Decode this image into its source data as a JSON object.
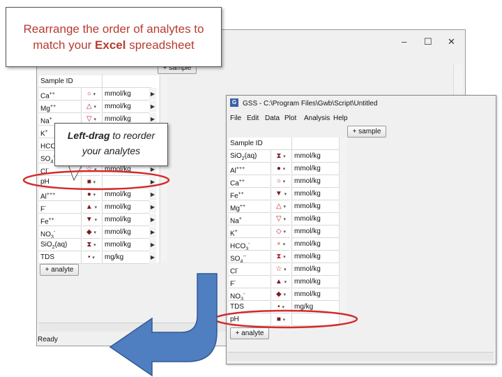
{
  "back_window": {
    "buttons": {
      "add_sample": "+ sample",
      "add_analyte": "+ analyte"
    },
    "status": "Ready",
    "sample_id_label": "Sample ID",
    "rows": [
      {
        "name": "Ca++",
        "unit": "mmol/kg"
      },
      {
        "name": "Mg++",
        "unit": "mmol/kg"
      },
      {
        "name": "Na+",
        "unit": "mmol/kg"
      },
      {
        "name": "K+",
        "unit": ""
      },
      {
        "name": "HCO3-",
        "unit": ""
      },
      {
        "name": "SO4--",
        "unit": ""
      },
      {
        "name": "Cl-",
        "unit": "mmol/kg"
      },
      {
        "name": "pH",
        "unit": ""
      },
      {
        "name": "Al+++",
        "unit": "mmol/kg"
      },
      {
        "name": "F-",
        "unit": "mmol/kg"
      },
      {
        "name": "Fe++",
        "unit": "mmol/kg"
      },
      {
        "name": "NO3-",
        "unit": "mmol/kg"
      },
      {
        "name": "SiO2(aq)",
        "unit": "mmol/kg"
      },
      {
        "name": "TDS",
        "unit": "mg/kg"
      }
    ],
    "window_controls": {
      "minimize": "–",
      "maximize": "☐",
      "close": "✕"
    }
  },
  "front_window": {
    "title": "GSS - C:\\Program Files\\Gwb\\Script\\Untitled",
    "menu": [
      "File",
      "Edit",
      "Data",
      "Plot",
      "Analysis",
      "Help"
    ],
    "buttons": {
      "add_sample": "+ sample",
      "add_analyte": "+ analyte"
    },
    "sample_id_label": "Sample ID",
    "rows": [
      {
        "name": "SiO2(aq)",
        "unit": "mmol/kg"
      },
      {
        "name": "Al+++",
        "unit": "mmol/kg"
      },
      {
        "name": "Ca++",
        "unit": "mmol/kg"
      },
      {
        "name": "Fe++",
        "unit": "mmol/kg"
      },
      {
        "name": "Mg++",
        "unit": "mmol/kg"
      },
      {
        "name": "Na+",
        "unit": "mmol/kg"
      },
      {
        "name": "K+",
        "unit": "mmol/kg"
      },
      {
        "name": "HCO3-",
        "unit": "mmol/kg"
      },
      {
        "name": "SO4--",
        "unit": "mmol/kg"
      },
      {
        "name": "Cl-",
        "unit": "mmol/kg"
      },
      {
        "name": "F-",
        "unit": "mmol/kg"
      },
      {
        "name": "NO3-",
        "unit": "mmol/kg"
      },
      {
        "name": "TDS",
        "unit": "mg/kg"
      },
      {
        "name": "pH",
        "unit": ""
      }
    ]
  },
  "callouts": {
    "top_line1": "Rearrange the order of analytes to",
    "top_line2_pre": "match your ",
    "top_line2_bold": "Excel",
    "top_line2_post": " spreadsheet",
    "mid_bold": "Left-drag",
    "mid_rest1": " to reorder",
    "mid_line2": "your analytes"
  },
  "colors": {
    "callout_text": "#b83a30",
    "highlight_ellipse": "#d42a2a",
    "arrow_fill": "#4f7fc0",
    "symbol_red": "#b8232b"
  }
}
